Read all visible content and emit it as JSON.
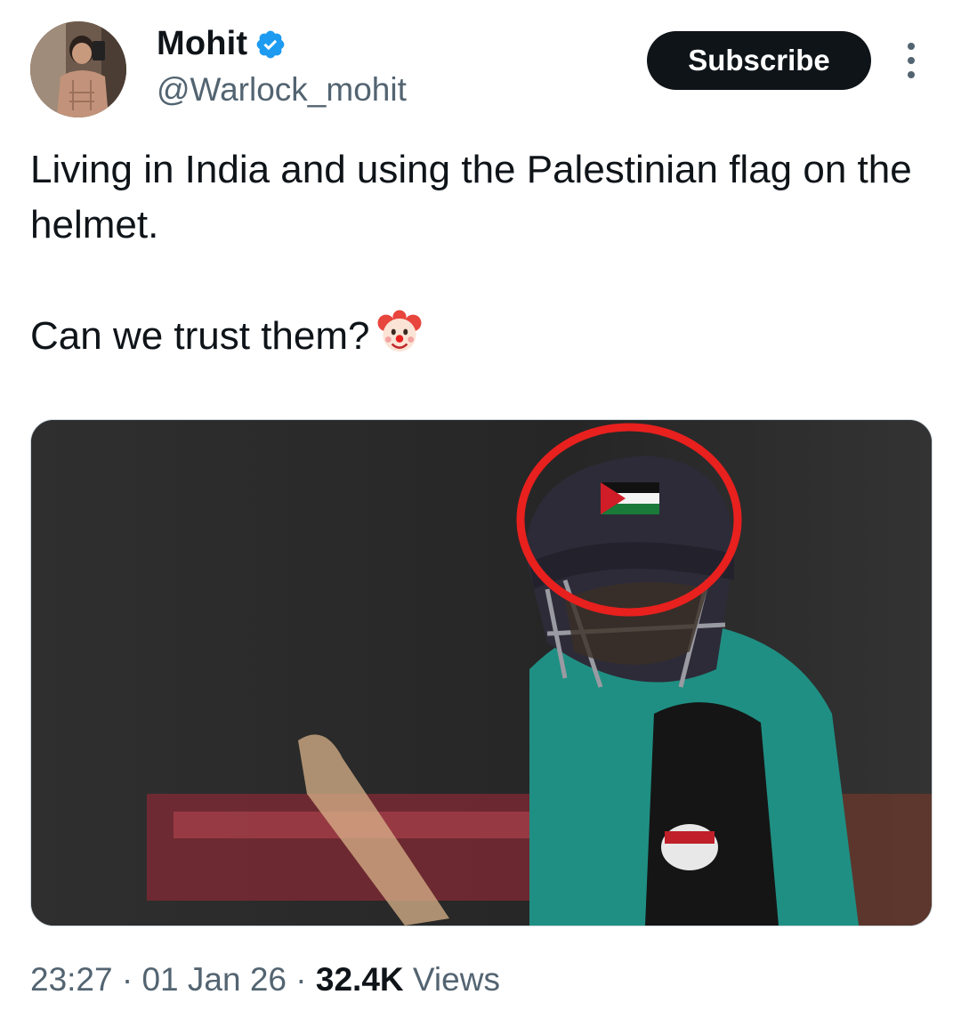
{
  "author": {
    "display_name": "Mohit",
    "handle": "@Warlock_mohit",
    "verified": true,
    "avatar_icon": "avatar-photo"
  },
  "actions": {
    "subscribe_label": "Subscribe",
    "more_icon": "more-vertical-icon"
  },
  "tweet": {
    "line1": "Living in India and using the Palestinian flag on the helmet.",
    "line2": "Can we trust them?",
    "emoji": "clown-face-emoji"
  },
  "media": {
    "description_icon": "cricket-photo",
    "highlight_color": "#e8201e"
  },
  "meta": {
    "time": "23:27",
    "separator": " · ",
    "date": "01 Jan 26",
    "views_count": "32.4K",
    "views_label": "Views"
  },
  "colors": {
    "text": "#0f1419",
    "secondary": "#536471",
    "verified": "#1d9bf0",
    "button_bg": "#0f1419"
  }
}
